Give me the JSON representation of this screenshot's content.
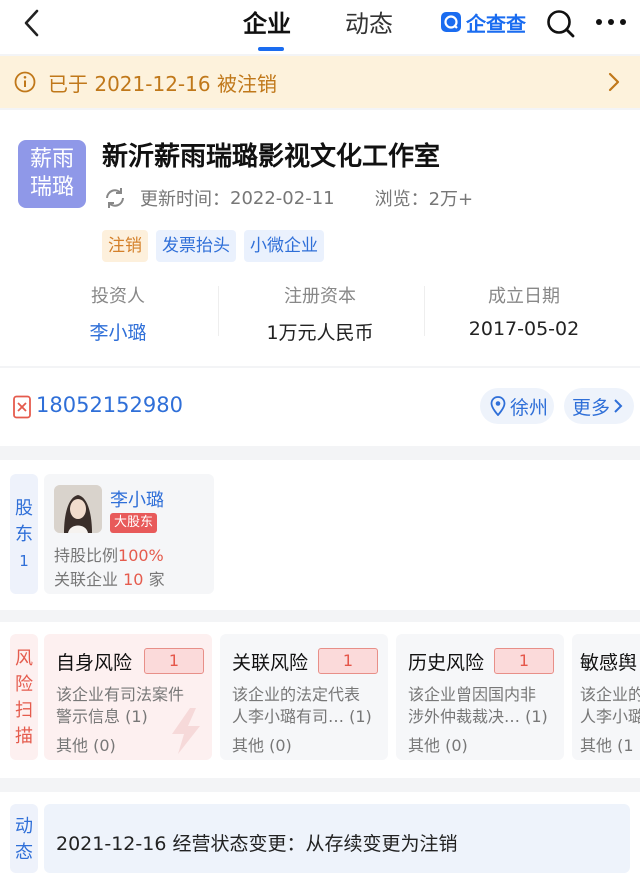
{
  "nav": {
    "tabs": [
      "企业",
      "动态"
    ],
    "active_tab": 0,
    "brand": "企查查",
    "icons": [
      "back-chevron-icon",
      "search-icon",
      "more-icon"
    ]
  },
  "banner": {
    "text": "已于 2021-12-16 被注销"
  },
  "company": {
    "logo_line1": "薪雨",
    "logo_line2": "瑞璐",
    "name": "新沂薪雨瑞璐影视文化工作室",
    "update_label": "更新时间：",
    "update_date": "2022-02-11",
    "views": "浏览：2万+",
    "tags": [
      "注销",
      "发票抬头",
      "小微企业"
    ]
  },
  "stats": [
    {
      "label": "投资人",
      "value": "李小璐"
    },
    {
      "label": "注册资本",
      "value": "1万元人民币"
    },
    {
      "label": "成立日期",
      "value": "2017-05-02"
    }
  ],
  "contact": {
    "phone": "18052152980",
    "city": "徐州",
    "more": "更多"
  },
  "shareholders": {
    "label_chars": [
      "股",
      "东",
      "1"
    ],
    "name": "李小璐",
    "badge": "大股东",
    "ratio_label": "持股比例",
    "ratio_value": "100%",
    "related_label": "关联企业",
    "related_value": "10",
    "related_unit": "家"
  },
  "risk": {
    "label_chars": [
      "风",
      "险",
      "扫",
      "描"
    ],
    "cards": [
      {
        "title": "自身风险",
        "count": "1",
        "desc1": "该企业有司法案件",
        "desc2": "警示信息 (1)",
        "other": "其他 (0)"
      },
      {
        "title": "关联风险",
        "count": "1",
        "desc1": "该企业的法定代表",
        "desc2": "人李小璐有司… (1)",
        "other": "其他 (0)"
      },
      {
        "title": "历史风险",
        "count": "1",
        "desc1": "该企业曾因国内非",
        "desc2": "涉外仲裁裁决… (1)",
        "other": "其他 (0)"
      },
      {
        "title": "敏感舆",
        "count": "",
        "desc1": "该企业的",
        "desc2": "人李小璐",
        "other": "其他 (1"
      }
    ]
  },
  "dynamics": {
    "label_chars": [
      "动",
      "态"
    ],
    "text": "2021-12-16 经营状态变更：从存续变更为注销"
  }
}
